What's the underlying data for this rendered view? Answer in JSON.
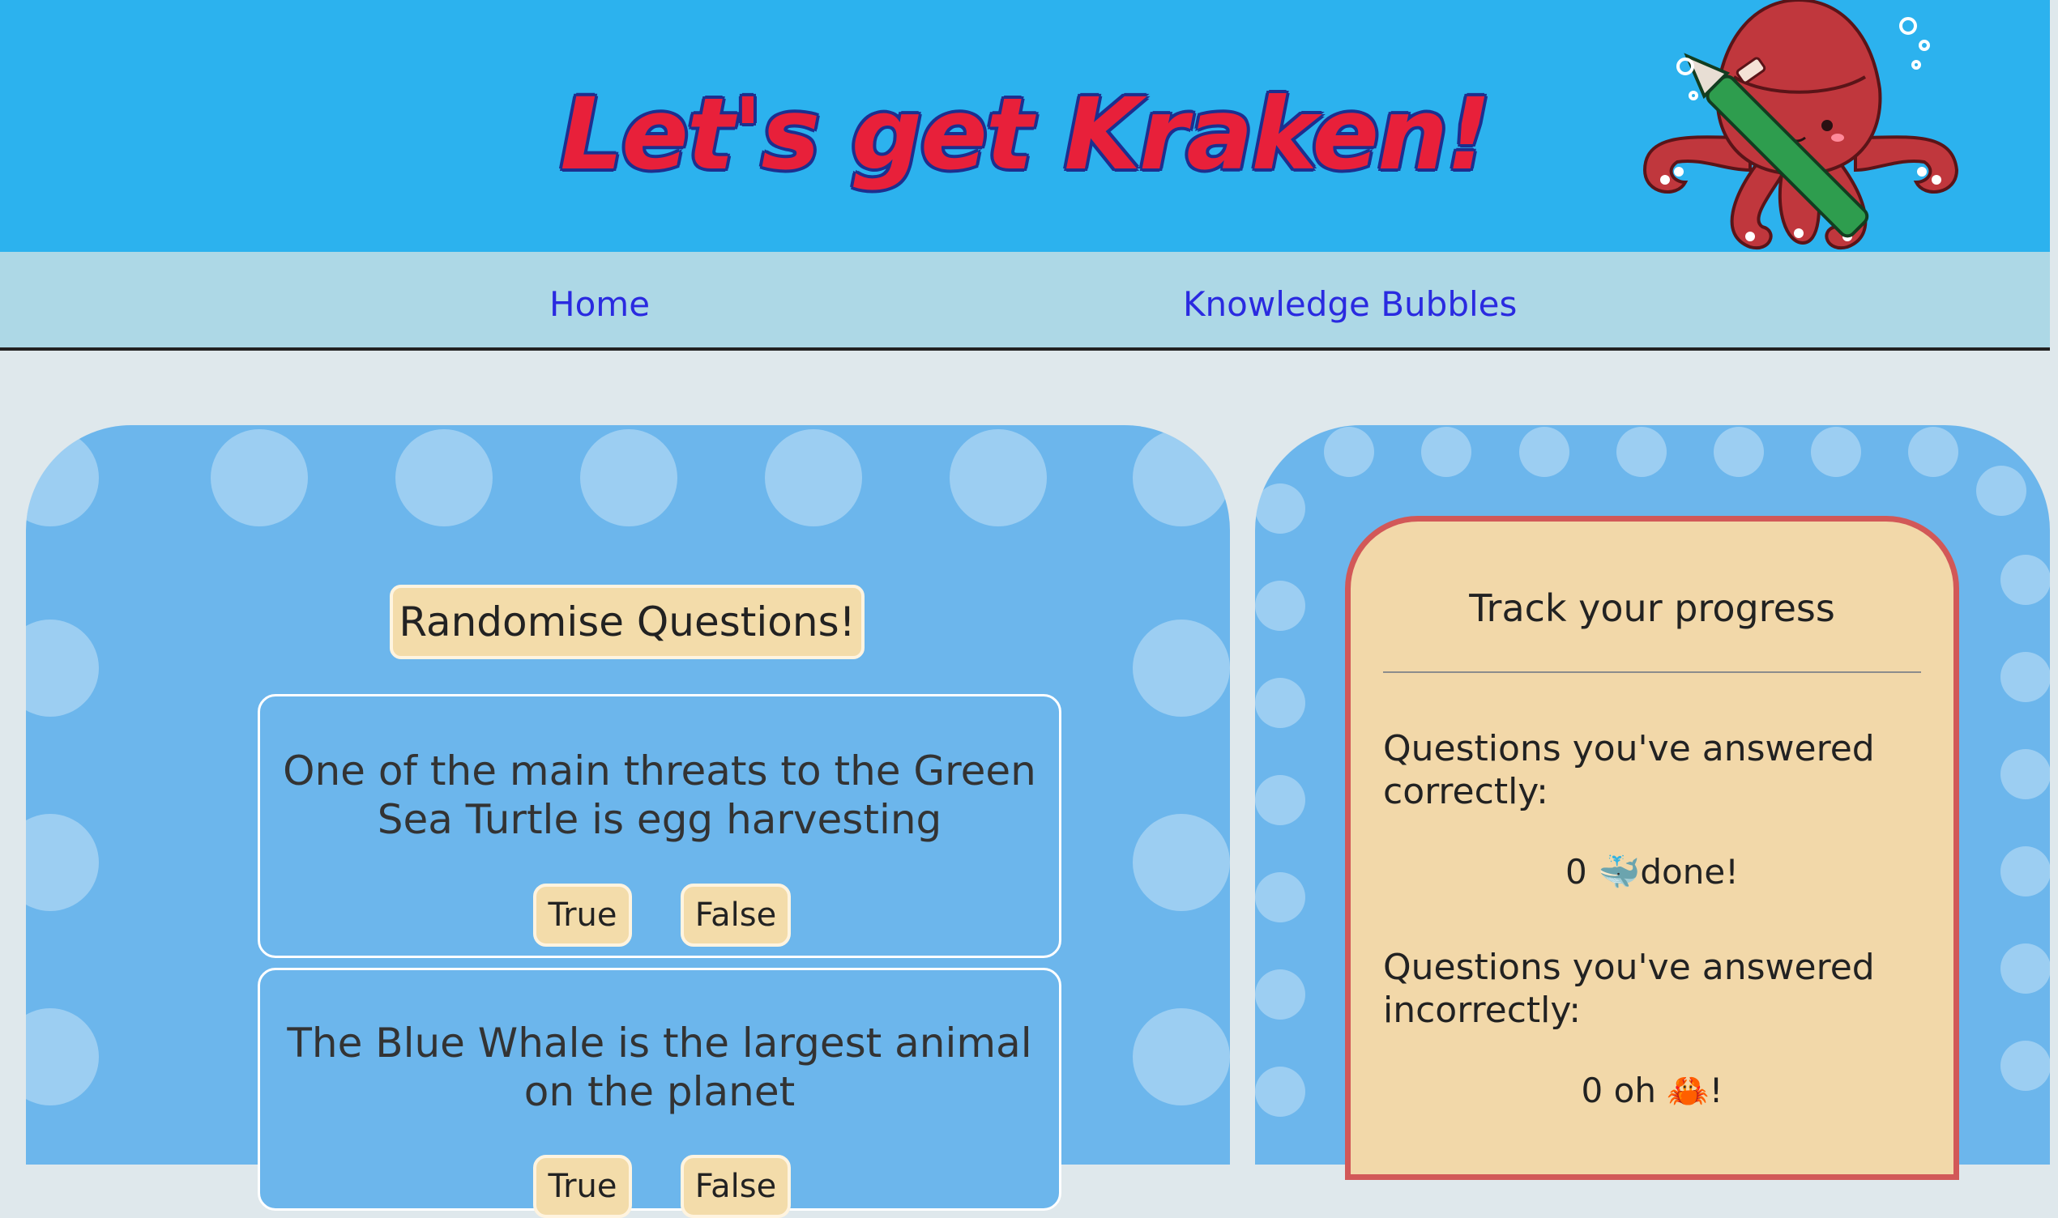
{
  "header": {
    "title": "Let's get Kraken!"
  },
  "nav": {
    "items": [
      {
        "label": "Home"
      },
      {
        "label": "Knowledge Bubbles"
      }
    ]
  },
  "quiz": {
    "randomise_label": "Randomise Questions!",
    "questions": [
      {
        "text": "One of the main threats to the Green Sea Turtle is egg harvesting",
        "true_label": "True",
        "false_label": "False"
      },
      {
        "text": "The Blue Whale is the largest animal on the planet",
        "true_label": "True",
        "false_label": "False"
      }
    ]
  },
  "progress": {
    "title": "Track your progress",
    "correct_label": "Questions you've answered correctly:",
    "correct_count": "0",
    "correct_emoji": "🐳",
    "correct_suffix": "done!",
    "incorrect_label": "Questions you've answered incorrectly:",
    "incorrect_count": "0",
    "incorrect_text": "oh",
    "incorrect_emoji": "🦀",
    "incorrect_suffix": "!"
  },
  "colors": {
    "header_bg": "#2cb2ee",
    "nav_bg": "#add8e6",
    "nav_link": "#2a2ae0",
    "panel_bg": "#6cb6ec",
    "button_bg": "#f3dcaa",
    "progress_border": "#d25858",
    "title_red": "#e8203a",
    "title_outline": "#1d2f8f"
  },
  "icons": {
    "mascot": "kraken-squid-with-pen-icon"
  }
}
